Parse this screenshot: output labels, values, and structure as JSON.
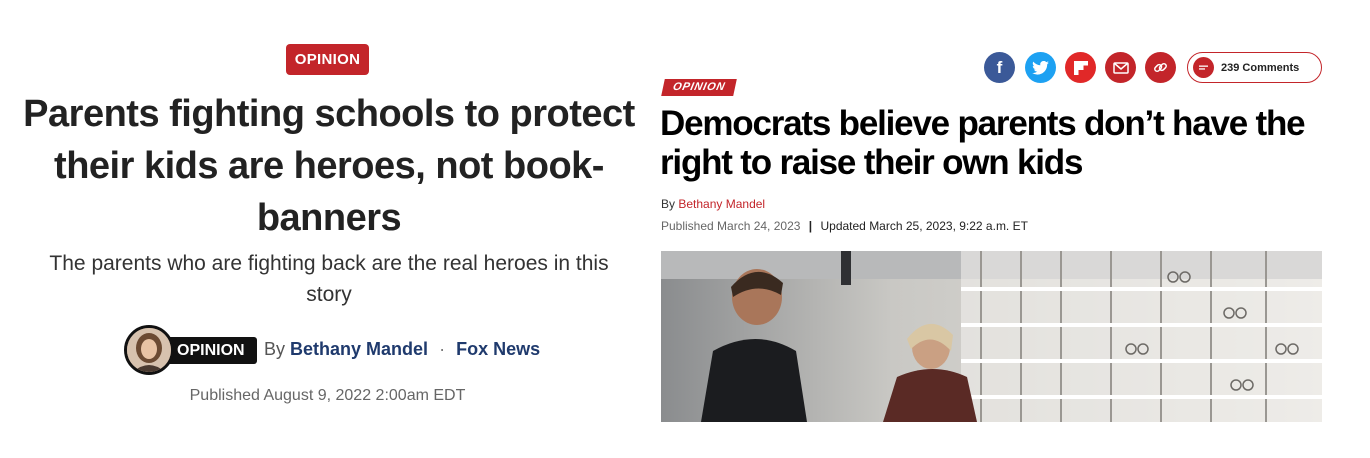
{
  "left_article": {
    "badge": "OPINION",
    "headline": "Parents fighting schools to protect their kids are heroes, not book-banners",
    "dek": "The parents who are fighting back are the real heroes in this story",
    "byline": {
      "tag": "OPINION",
      "by": "By",
      "author": "Bethany Mandel",
      "separator": "·",
      "source": "Fox News"
    },
    "published": "Published August 9, 2022 2:00am EDT",
    "colors": {
      "badge": "#c3252a",
      "link": "#1f3a6d"
    }
  },
  "right_article": {
    "share": {
      "icons": [
        "facebook-icon",
        "twitter-icon",
        "flipboard-icon",
        "email-icon",
        "link-icon"
      ],
      "comments_label": "239 Comments"
    },
    "badge": "OPINION",
    "headline": "Democrats believe parents don’t have the right to raise their own kids",
    "by": "By",
    "author": "Bethany Mandel",
    "published": "Published March 24, 2023",
    "separator": "|",
    "updated": "Updated March 25, 2023, 9:22 a.m. ET",
    "colors": {
      "accent": "#c3252a"
    }
  }
}
